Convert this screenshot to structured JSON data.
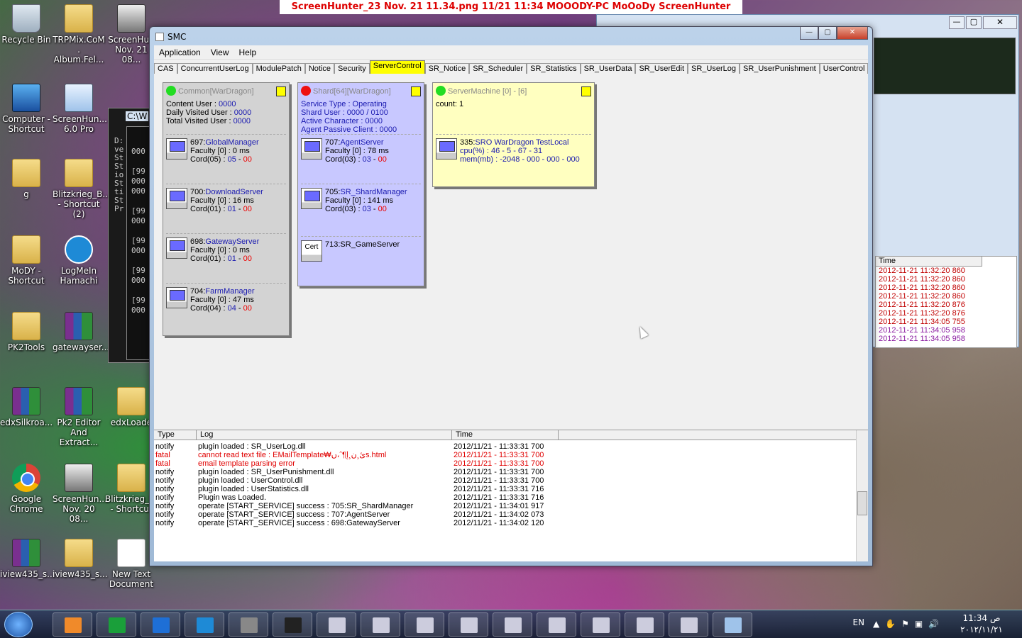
{
  "top_caption": "ScreenHunter_23 Nov. 21 11.34.png  11/21  11:34  MOOODY-PC  MoOoDy  ScreenHunter",
  "desktop_icons": [
    {
      "label": "Recycle Bin",
      "icon": "recycle-bin-icon"
    },
    {
      "label": "TRPMix.CoM . Album.Fel...",
      "icon": "folder-shortcut-icon"
    },
    {
      "label": "ScreenHun Nov. 21 08...",
      "icon": "screenshot-file-icon"
    },
    {
      "label": "Computer - Shortcut",
      "icon": "computer-icon"
    },
    {
      "label": "ScreenHun... 6.0 Pro",
      "icon": "screenhunter-icon"
    },
    {
      "label": "g",
      "icon": "folder-icon"
    },
    {
      "label": "Blitzkrieg_B... - Shortcut (2)",
      "icon": "folder-shortcut-icon"
    },
    {
      "label": "MoDY - Shortcut",
      "icon": "folder-shortcut-icon"
    },
    {
      "label": "LogMeIn Hamachi",
      "icon": "hamachi-icon"
    },
    {
      "label": "PK2Tools",
      "icon": "folder-icon"
    },
    {
      "label": "gatewayser...",
      "icon": "winrar-icon"
    },
    {
      "label": "edxSilkroa...",
      "icon": "winrar-icon"
    },
    {
      "label": "Pk2 Editor And Extract...",
      "icon": "winrar-icon"
    },
    {
      "label": "edxLoade",
      "icon": "folder-shortcut-icon"
    },
    {
      "label": "Google Chrome",
      "icon": "chrome-icon"
    },
    {
      "label": "ScreenHun... Nov. 20 08...",
      "icon": "screenshot-file-icon"
    },
    {
      "label": "Blitzkrieg_I... - Shortcut",
      "icon": "folder-shortcut-icon"
    },
    {
      "label": "iview435_s...",
      "icon": "winrar-icon"
    },
    {
      "label": "iview435_s...",
      "icon": "folder-icon"
    },
    {
      "label": "New Text Document",
      "icon": "text-document-icon"
    }
  ],
  "window": {
    "title": "SMC",
    "minimize": "—",
    "maximize": "▢",
    "close": "✕"
  },
  "menu": [
    "Application",
    "View",
    "Help"
  ],
  "tabs": [
    "CAS",
    "ConcurrentUserLog",
    "ModulePatch",
    "Notice",
    "Security",
    "ServerControl",
    "SR_Notice",
    "SR_Scheduler",
    "SR_Statistics",
    "SR_UserData",
    "SR_UserEdit",
    "SR_UserLog",
    "SR_UserPunishment",
    "UserControl"
  ],
  "active_tab": "ServerControl",
  "common": {
    "header": "Common[WarDragon]",
    "lines": [
      [
        "Content User : ",
        "0000"
      ],
      [
        "Daily Visited User : ",
        "0000"
      ],
      [
        "Total Visited User : ",
        "0000"
      ]
    ],
    "servers": [
      {
        "id": "697:",
        "name": "GlobalManager",
        "faculty": "Faculty [0] : 0 ms",
        "cord_label": "Cord(05) : ",
        "cord_a": "05",
        "cord_b": "00"
      },
      {
        "id": "700:",
        "name": "DownloadServer",
        "faculty": "Faculty [0] : 16 ms",
        "cord_label": "Cord(01) : ",
        "cord_a": "01",
        "cord_b": "00"
      },
      {
        "id": "698:",
        "name": "GatewayServer",
        "faculty": "Faculty [0] : 0 ms",
        "cord_label": "Cord(01) : ",
        "cord_a": "01",
        "cord_b": "00"
      },
      {
        "id": "704:",
        "name": "FarmManager",
        "faculty": "Faculty [0] : 47 ms",
        "cord_label": "Cord(04) : ",
        "cord_a": "04",
        "cord_b": "00"
      }
    ]
  },
  "shard": {
    "header": "Shard[64][WarDragon]",
    "lines": [
      "Service Type : Operating",
      "Shard User : 0000 / 0100",
      "Active Character : 0000",
      "Agent Passive Client : 0000"
    ],
    "servers": [
      {
        "id": "707:",
        "name": "AgentServer",
        "faculty": "Faculty [0] : 78 ms",
        "cord_label": "Cord(03) : ",
        "cord_a": "03",
        "cord_b": "00"
      },
      {
        "id": "705:",
        "name": "SR_ShardManager",
        "faculty": "Faculty [0] : 141 ms",
        "cord_label": "Cord(03) : ",
        "cord_a": "03",
        "cord_b": "00"
      }
    ],
    "cert_server": {
      "icon_text": "Cert",
      "label": "713:SR_GameServer"
    }
  },
  "machine": {
    "header": "ServerMachine [0] - [6]",
    "count": "count: 1",
    "entry_id": "335:",
    "entry_name": "SRO WarDragon TestLocal",
    "cpu": "cpu(%) : 46 - 5 - 67 - 31",
    "mem": "mem(mb) : -2048 - 000 - 000 - 000"
  },
  "log": {
    "columns": [
      "Type",
      "Log",
      "Time"
    ],
    "rows": [
      {
        "type": "notify",
        "log": "plugin loaded : SR_UserLog.dll",
        "time": "2012/11/21 - 11:33:31 700",
        "level": "notify"
      },
      {
        "type": "fatal",
        "log": "cannot read text file : EMailTemplate₩ئ¸ن¸إ¶ˆ،ںs.html",
        "time": "2012/11/21 - 11:33:31 700",
        "level": "fatal"
      },
      {
        "type": "fatal",
        "log": "email template parsing error",
        "time": "2012/11/21 - 11:33:31 700",
        "level": "fatal"
      },
      {
        "type": "notify",
        "log": "plugin loaded : SR_UserPunishment.dll",
        "time": "2012/11/21 - 11:33:31 700",
        "level": "notify"
      },
      {
        "type": "notify",
        "log": "plugin loaded : UserControl.dll",
        "time": "2012/11/21 - 11:33:31 700",
        "level": "notify"
      },
      {
        "type": "notify",
        "log": "plugin loaded : UserStatistics.dll",
        "time": "2012/11/21 - 11:33:31 716",
        "level": "notify"
      },
      {
        "type": "notify",
        "log": "Plugin was Loaded.",
        "time": "2012/11/21 - 11:33:31 716",
        "level": "notify"
      },
      {
        "type": "notify",
        "log": "operate [START_SERVICE] success : 705:SR_ShardManager",
        "time": "2012/11/21 - 11:34:01 917",
        "level": "notify"
      },
      {
        "type": "notify",
        "log": "operate [START_SERVICE] success : 707:AgentServer",
        "time": "2012/11/21 - 11:34:02 073",
        "level": "notify"
      },
      {
        "type": "notify",
        "log": "operate [START_SERVICE] success : 698:GatewayServer",
        "time": "2012/11/21 - 11:34:02 120",
        "level": "notify"
      }
    ]
  },
  "bg_log": {
    "header": "Time",
    "times": [
      "2012-11-21 11:32:20 860",
      "2012-11-21 11:32:20 860",
      "2012-11-21 11:32:20 860",
      "2012-11-21 11:32:20 860",
      "2012-11-21 11:32:20 876",
      "2012-11-21 11:32:20 876",
      "2012-11-21 11:34:05 755",
      "2012-11-21 11:34:05 958",
      "2012-11-21 11:34:05 958"
    ]
  },
  "console_lines": [
    "D:",
    "ve",
    "St",
    "St",
    "io",
    "St",
    "ti",
    "St",
    "Pr"
  ],
  "console_title": "C:\\W",
  "taskbar": {
    "lang": "EN",
    "clock_time": "11:34 ص",
    "clock_date": "٢٠١٢/١١/٢١"
  },
  "colors": {
    "tab_active": "#ffff00",
    "common_bg": "#d3d3d3",
    "shard_bg": "#c8c8ff",
    "machine_bg": "#ffffc0",
    "fatal": "#e00000",
    "blue_text": "#1a1ab0"
  }
}
